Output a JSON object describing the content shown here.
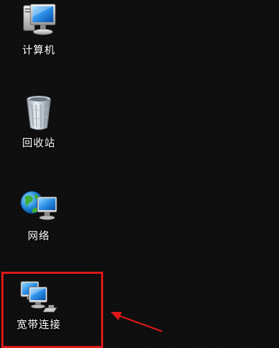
{
  "desktop": {
    "icons": [
      {
        "label": "计算机",
        "icon": "computer-icon"
      },
      {
        "label": "回收站",
        "icon": "recycle-bin-icon"
      },
      {
        "label": "网络",
        "icon": "network-icon"
      },
      {
        "label": "宽带连接",
        "icon": "broadband-connection-icon"
      }
    ]
  },
  "annotation": {
    "highlight_color": "#e01818"
  }
}
